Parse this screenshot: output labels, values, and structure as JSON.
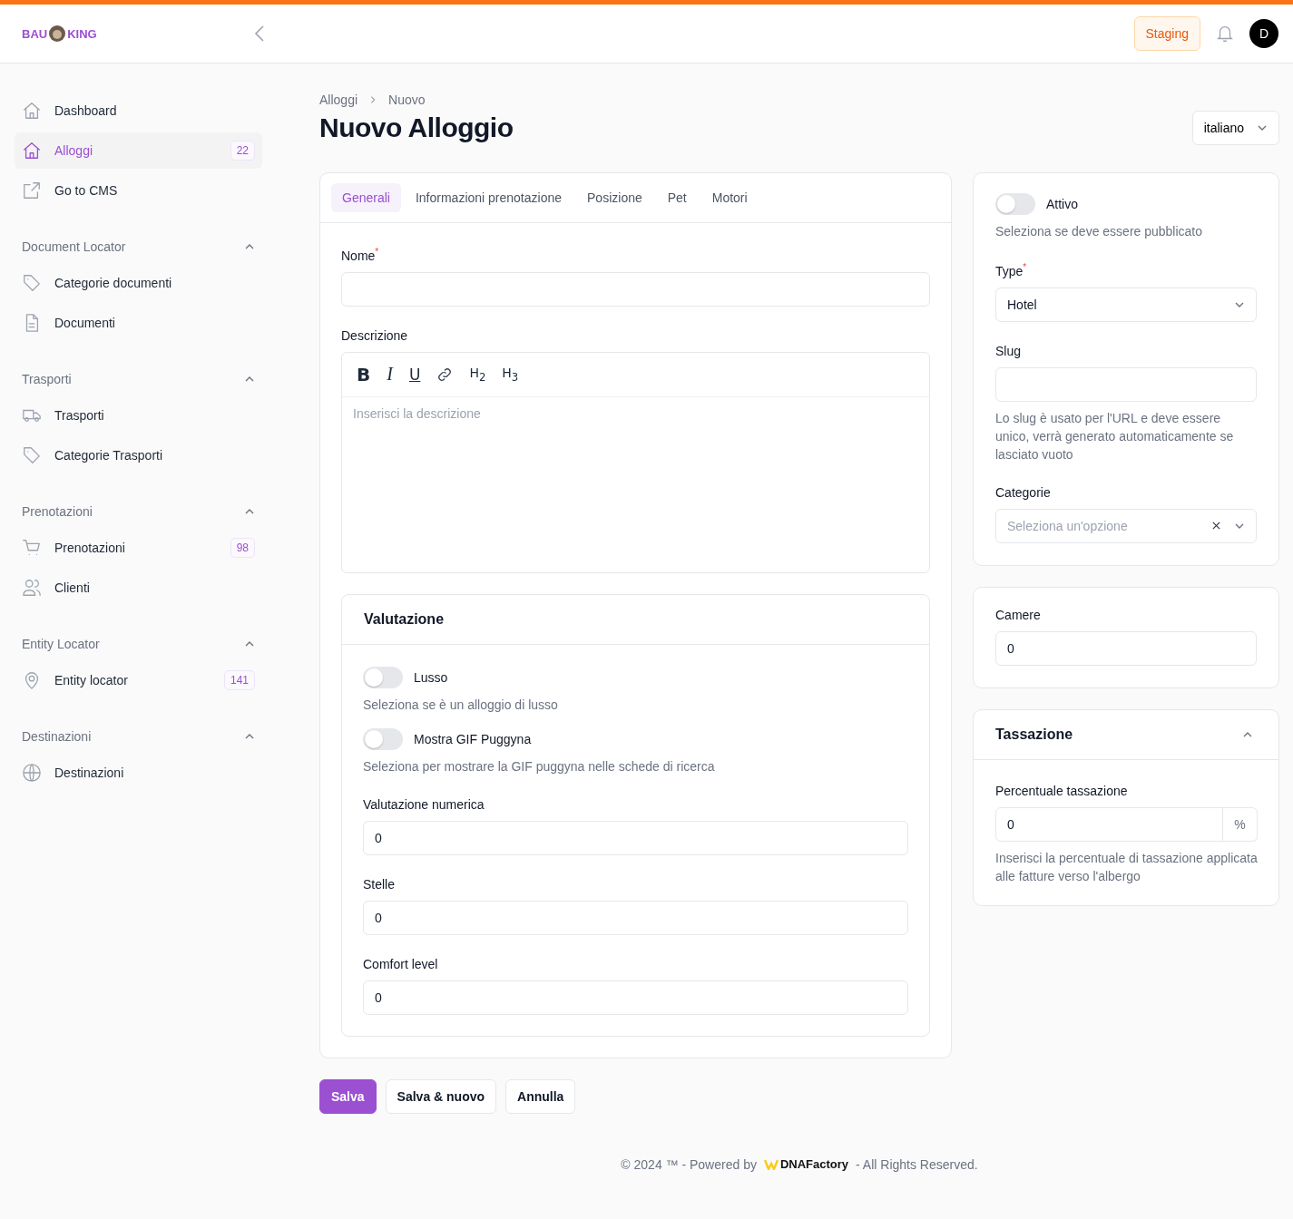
{
  "header": {
    "logo": {
      "left": "BAU",
      "right": "KING"
    },
    "environment": "Staging",
    "avatar": "D"
  },
  "sidebar": {
    "groups": [
      {
        "items": [
          {
            "label": "Dashboard",
            "selected": false
          },
          {
            "label": "Alloggi",
            "selected": true,
            "badge": "22"
          },
          {
            "label": "Go to CMS",
            "selected": false
          }
        ]
      },
      {
        "title": "Document Locator",
        "expanded": true,
        "items": [
          {
            "label": "Categorie documenti",
            "selected": false
          },
          {
            "label": "Documenti",
            "selected": false
          }
        ]
      },
      {
        "title": "Trasporti",
        "expanded": true,
        "items": [
          {
            "label": "Trasporti",
            "selected": false
          },
          {
            "label": "Categorie Trasporti",
            "selected": false
          }
        ]
      },
      {
        "title": "Prenotazioni",
        "expanded": true,
        "items": [
          {
            "label": "Prenotazioni",
            "selected": false,
            "badge": "98"
          },
          {
            "label": "Clienti",
            "selected": false
          }
        ]
      },
      {
        "title": "Entity Locator",
        "expanded": true,
        "items": [
          {
            "label": "Entity locator",
            "selected": false,
            "badge": "141"
          }
        ]
      },
      {
        "title": "Destinazioni",
        "expanded": true,
        "items": [
          {
            "label": "Destinazioni",
            "selected": false
          }
        ]
      }
    ]
  },
  "breadcrumb": [
    "Alloggi",
    "Nuovo"
  ],
  "title": "Nuovo Alloggio",
  "language": "italiano",
  "tabs": [
    {
      "label": "Generali",
      "selected": true
    },
    {
      "label": "Informazioni prenotazione",
      "selected": false
    },
    {
      "label": "Posizione",
      "selected": false
    },
    {
      "label": "Pet",
      "selected": false
    },
    {
      "label": "Motori",
      "selected": false
    }
  ],
  "name_field": {
    "label": "Nome",
    "required_mark": "*"
  },
  "description": {
    "label": "Descrizione",
    "toolbar": [
      {
        "kind": "bold",
        "text": "B"
      },
      {
        "kind": "italic",
        "text": "I"
      },
      {
        "kind": "underline",
        "text": "U"
      },
      {
        "kind": "link"
      },
      {
        "kind": "heading",
        "text": "H$_{2}$"
      },
      {
        "kind": "heading",
        "text": "H$_{3}$"
      }
    ],
    "placeholder": "Inserisci la descrizione"
  },
  "valutazione": {
    "title": "Valutazione",
    "toggles": [
      {
        "label": "Lusso",
        "on": false,
        "help": "Seleziona se è un alloggio di lusso"
      },
      {
        "label": "Mostra GIF Puggyna",
        "on": false,
        "help": "Seleziona per mostrare la GIF puggyna nelle schede di ricerca"
      }
    ],
    "fields": [
      {
        "label": "Valutazione numerica",
        "value": "0"
      },
      {
        "label": "Stelle",
        "value": "0"
      },
      {
        "label": "Comfort level",
        "value": "0"
      }
    ]
  },
  "actions": [
    {
      "label": "Salva",
      "kind": "primary"
    },
    {
      "label": "Salva & nuovo",
      "kind": "secondary"
    },
    {
      "label": "Annulla",
      "kind": "secondary"
    }
  ],
  "side": {
    "active": {
      "label": "Attivo",
      "on": false,
      "help": "Seleziona se deve essere pubblicato"
    },
    "type": {
      "label": "Type",
      "required_mark": "*",
      "value": "Hotel"
    },
    "slug": {
      "label": "Slug",
      "help": "Lo slug è usato per l'URL e deve essere unico, verrà generato automaticamente se lasciato vuoto"
    },
    "categorie": {
      "label": "Categorie",
      "placeholder": "Seleziona un'opzione"
    },
    "camere": {
      "label": "Camere",
      "value": "0"
    },
    "tassazione": {
      "title": "Tassazione",
      "expanded": true,
      "label": "Percentuale tassazione",
      "value": "0",
      "suffix": "%",
      "help": "Inserisci la percentuale di tassazione applicata alle fatture verso l'albergo"
    }
  },
  "footer": {
    "before": "© 2024 ™ - Powered by",
    "brand": "DNAFactory",
    "after": "- All Rights Reserved."
  }
}
